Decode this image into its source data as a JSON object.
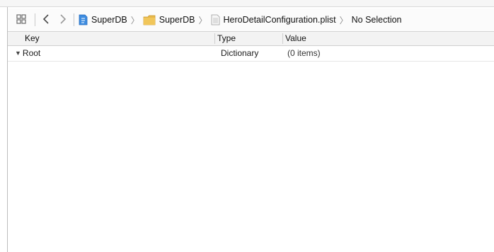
{
  "jumpbar": {
    "crumbs": [
      {
        "label": "SuperDB",
        "icon": "project-file-icon"
      },
      {
        "label": "SuperDB",
        "icon": "folder-icon"
      },
      {
        "label": "HeroDetailConfiguration.plist",
        "icon": "plist-file-icon"
      },
      {
        "label": "No Selection",
        "icon": ""
      }
    ]
  },
  "table": {
    "headers": {
      "key": "Key",
      "type": "Type",
      "value": "Value"
    },
    "rows": [
      {
        "key": "Root",
        "type": "Dictionary",
        "value": "(0 items)",
        "expanded": true
      }
    ]
  }
}
